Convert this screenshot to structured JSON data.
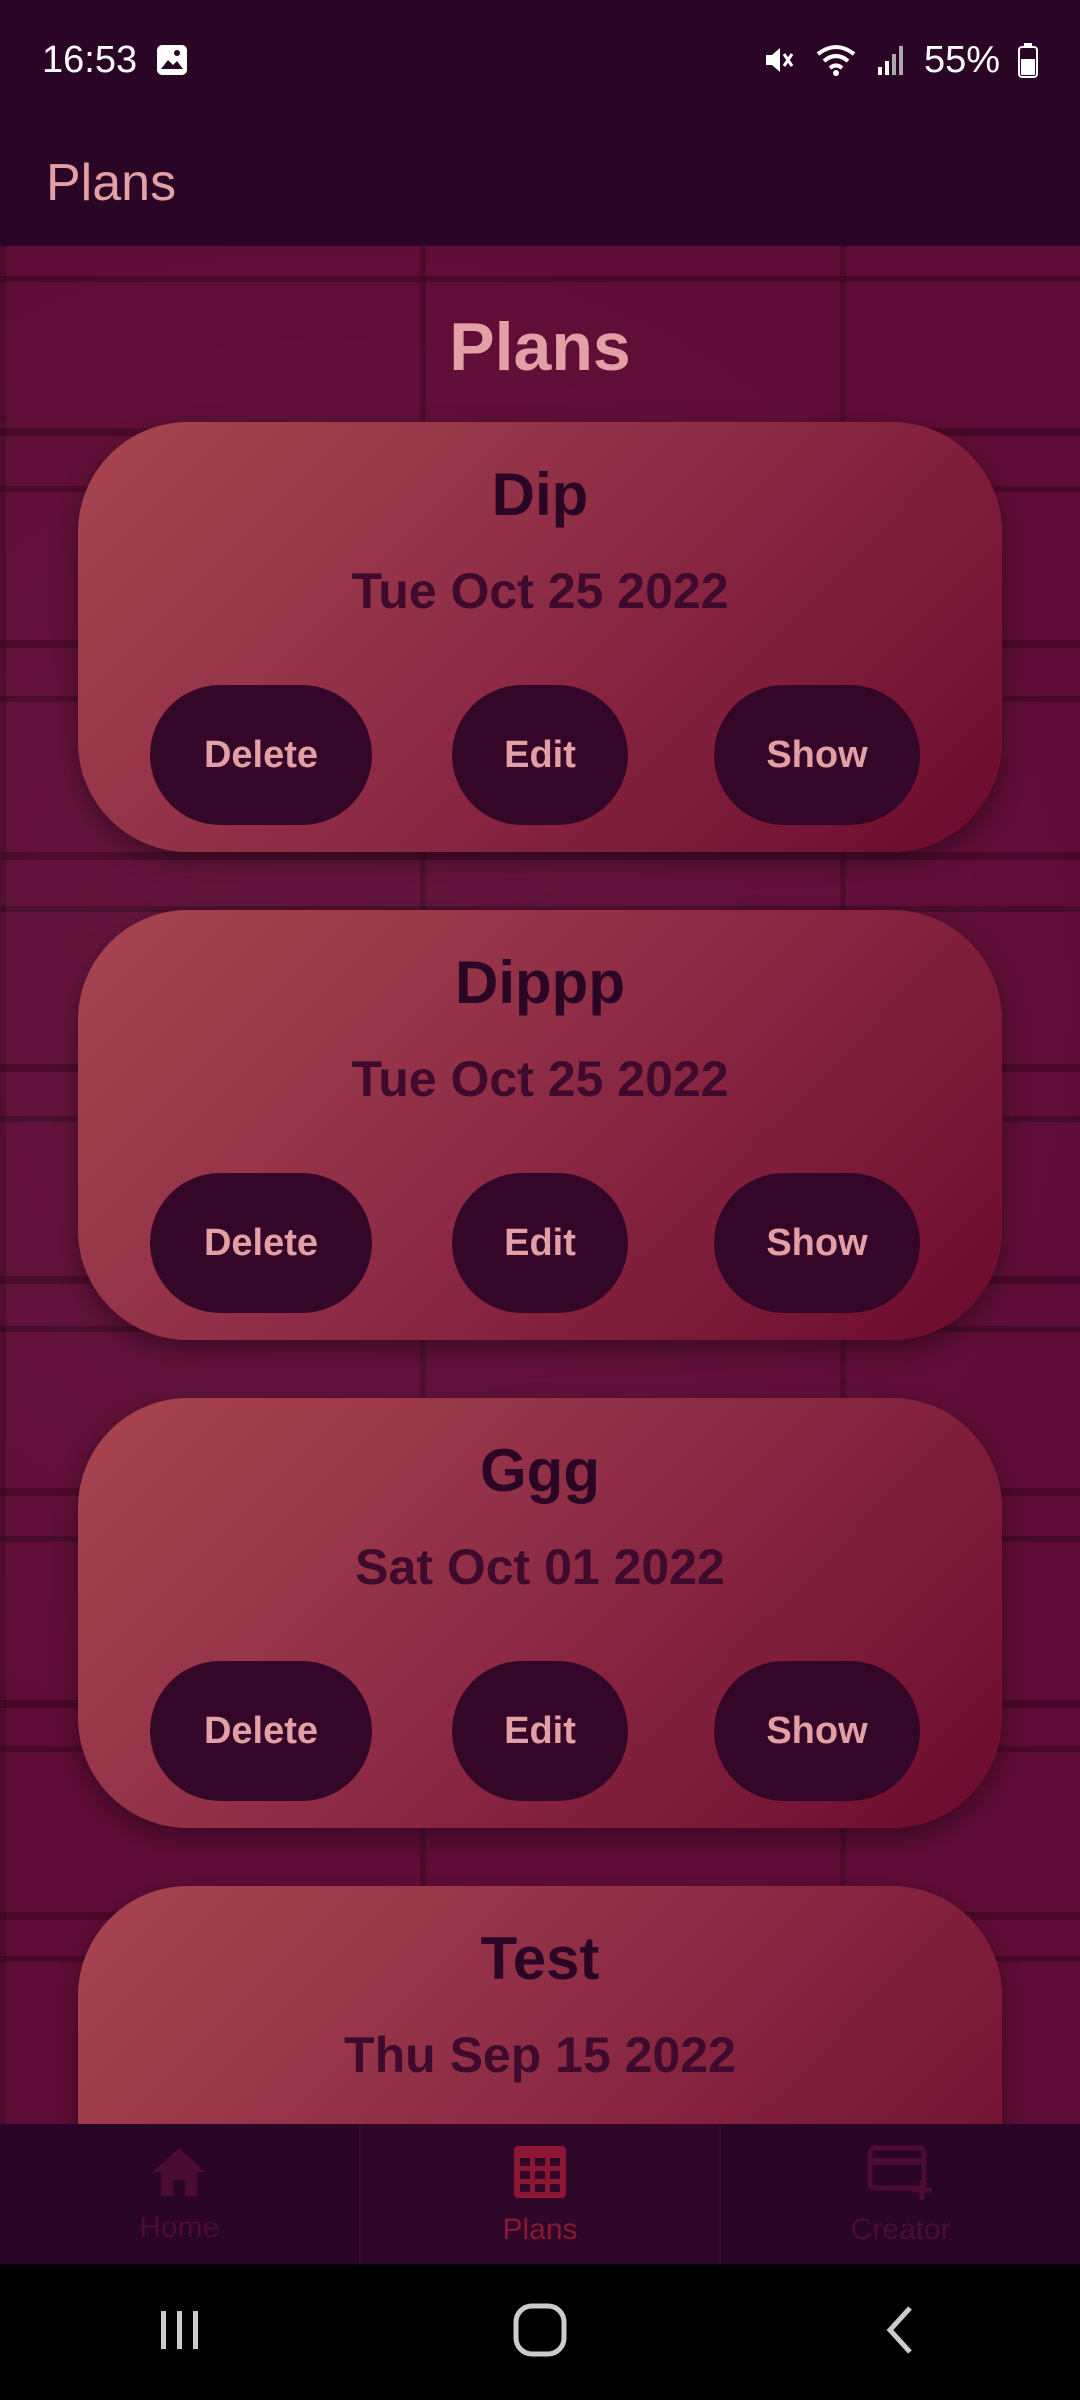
{
  "status_bar": {
    "time": "16:53",
    "battery": "55%",
    "icons": [
      "gallery-icon",
      "mute-icon",
      "wifi-icon",
      "signal-icon",
      "battery-icon"
    ]
  },
  "app_bar": {
    "title": "Plans"
  },
  "page": {
    "title": "Plans"
  },
  "plans": [
    {
      "name": "Dip",
      "date": "Tue Oct 25 2022",
      "delete_label": "Delete",
      "edit_label": "Edit",
      "show_label": "Show"
    },
    {
      "name": "Dippp",
      "date": "Tue Oct 25 2022",
      "delete_label": "Delete",
      "edit_label": "Edit",
      "show_label": "Show"
    },
    {
      "name": "Ggg",
      "date": "Sat Oct 01 2022",
      "delete_label": "Delete",
      "edit_label": "Edit",
      "show_label": "Show"
    },
    {
      "name": "Test",
      "date": "Thu Sep 15 2022"
    }
  ],
  "bottom_nav": {
    "items": [
      {
        "label": "Home",
        "icon": "home-icon",
        "active": false
      },
      {
        "label": "Plans",
        "icon": "calendar-grid-icon",
        "active": true
      },
      {
        "label": "Creator",
        "icon": "card-add-icon",
        "active": false
      }
    ]
  },
  "colors": {
    "background": "#2a0526",
    "accent_text": "#e2a0a6",
    "card_start": "#a8454f",
    "card_end": "#6b0a2d",
    "button": "#340628"
  }
}
